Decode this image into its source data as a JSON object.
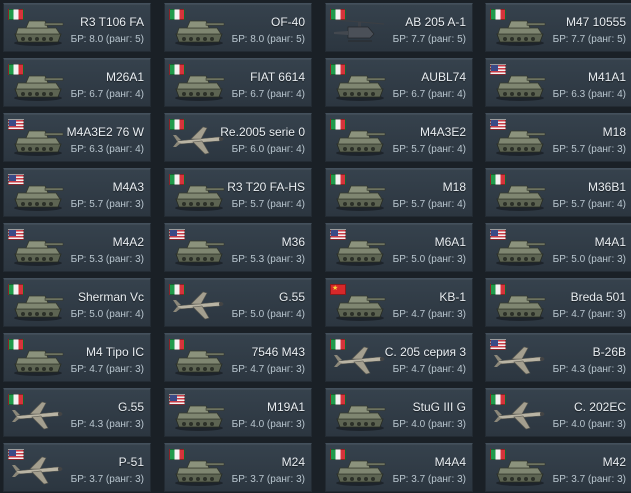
{
  "colors": {
    "background": "#1a2026",
    "card": "#323d48",
    "text": "#e9eef2",
    "subtext": "#b9c6cf"
  },
  "vehicles": [
    {
      "flag": "italy",
      "icon": "tank-icon",
      "name": "R3 T106 FA",
      "br": "БР: 8.0 (ранг: 5)"
    },
    {
      "flag": "italy",
      "icon": "tank-icon",
      "name": "OF-40",
      "br": "БР: 8.0 (ранг: 5)"
    },
    {
      "flag": "italy",
      "icon": "helicopter-icon",
      "name": "AB 205 A-1",
      "br": "БР: 7.7 (ранг: 5)"
    },
    {
      "flag": "italy",
      "icon": "tank-icon",
      "name": "M47 10555",
      "br": "БР: 7.7 (ранг: 5)"
    },
    {
      "flag": "italy",
      "icon": "tank-icon",
      "name": "M26A1",
      "br": "БР: 6.7 (ранг: 4)"
    },
    {
      "flag": "italy",
      "icon": "tank-icon",
      "name": "FIAT 6614",
      "br": "БР: 6.7 (ранг: 4)"
    },
    {
      "flag": "italy",
      "icon": "tank-icon",
      "name": "AUBL74",
      "br": "БР: 6.7 (ранг: 4)"
    },
    {
      "flag": "usa",
      "icon": "tank-icon",
      "name": "M41A1",
      "br": "БР: 6.3 (ранг: 4)"
    },
    {
      "flag": "usa",
      "icon": "tank-icon",
      "name": "M4A3E2 76 W",
      "br": "БР: 6.3 (ранг: 4)"
    },
    {
      "flag": "italy",
      "icon": "plane-icon",
      "name": "Re.2005 serie 0",
      "br": "БР: 6.0 (ранг: 4)"
    },
    {
      "flag": "italy",
      "icon": "tank-icon",
      "name": "M4A3E2",
      "br": "БР: 5.7 (ранг: 4)"
    },
    {
      "flag": "usa",
      "icon": "tank-icon",
      "name": "M18",
      "br": "БР: 5.7 (ранг: 3)"
    },
    {
      "flag": "usa",
      "icon": "tank-icon",
      "name": "M4A3",
      "br": "БР: 5.7 (ранг: 3)"
    },
    {
      "flag": "italy",
      "icon": "tank-icon",
      "name": "R3 T20 FA-HS",
      "br": "БР: 5.7 (ранг: 4)"
    },
    {
      "flag": "italy",
      "icon": "tank-icon",
      "name": "M18",
      "br": "БР: 5.7 (ранг: 4)"
    },
    {
      "flag": "italy",
      "icon": "tank-icon",
      "name": "M36B1",
      "br": "БР: 5.7 (ранг: 4)"
    },
    {
      "flag": "usa",
      "icon": "tank-icon",
      "name": "M4A2",
      "br": "БР: 5.3 (ранг: 3)"
    },
    {
      "flag": "usa",
      "icon": "tank-icon",
      "name": "M36",
      "br": "БР: 5.3 (ранг: 3)"
    },
    {
      "flag": "usa",
      "icon": "tank-icon",
      "name": "M6A1",
      "br": "БР: 5.0 (ранг: 3)"
    },
    {
      "flag": "usa",
      "icon": "tank-icon",
      "name": "M4A1",
      "br": "БР: 5.0 (ранг: 3)"
    },
    {
      "flag": "italy",
      "icon": "tank-icon",
      "name": "Sherman Vc",
      "br": "БР: 5.0 (ранг: 4)"
    },
    {
      "flag": "italy",
      "icon": "plane-icon",
      "name": "G.55",
      "br": "БР: 5.0 (ранг: 4)"
    },
    {
      "flag": "china",
      "icon": "tank-icon",
      "name": "KB-1",
      "br": "БР: 4.7 (ранг: 3)"
    },
    {
      "flag": "italy",
      "icon": "tank-icon",
      "name": "Breda 501",
      "br": "БР: 4.7 (ранг: 3)"
    },
    {
      "flag": "italy",
      "icon": "tank-icon",
      "name": "M4 Tipo IC",
      "br": "БР: 4.7 (ранг: 3)"
    },
    {
      "flag": "italy",
      "icon": "tank-icon",
      "name": "7546 M43",
      "br": "БР: 4.7 (ранг: 3)"
    },
    {
      "flag": "italy",
      "icon": "plane-icon",
      "name": "C. 205 серия 3",
      "br": "БР: 4.7 (ранг: 4)"
    },
    {
      "flag": "usa",
      "icon": "plane-icon",
      "name": "B-26B",
      "br": "БР: 4.3 (ранг: 3)"
    },
    {
      "flag": "italy",
      "icon": "plane-icon",
      "name": "G.55",
      "br": "БР: 4.3 (ранг: 3)"
    },
    {
      "flag": "usa",
      "icon": "tank-icon",
      "name": "M19A1",
      "br": "БР: 4.0 (ранг: 3)"
    },
    {
      "flag": "italy",
      "icon": "tank-icon",
      "name": "StuG III G",
      "br": "БР: 4.0 (ранг: 3)"
    },
    {
      "flag": "italy",
      "icon": "plane-icon",
      "name": "C. 202EC",
      "br": "БР: 4.0 (ранг: 3)"
    },
    {
      "flag": "usa",
      "icon": "plane-icon",
      "name": "P-51",
      "br": "БР: 3.7 (ранг: 3)"
    },
    {
      "flag": "italy",
      "icon": "tank-icon",
      "name": "M24",
      "br": "БР: 3.7 (ранг: 3)"
    },
    {
      "flag": "italy",
      "icon": "tank-icon",
      "name": "M4A4",
      "br": "БР: 3.7 (ранг: 3)"
    },
    {
      "flag": "italy",
      "icon": "tank-icon",
      "name": "M42",
      "br": "БР: 3.7 (ранг: 3)"
    }
  ]
}
